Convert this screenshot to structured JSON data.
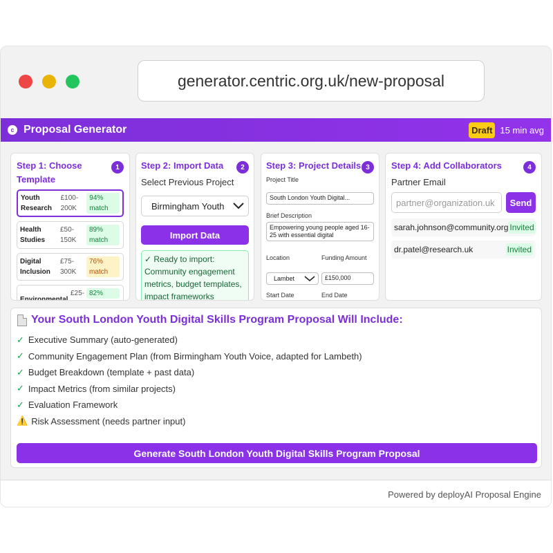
{
  "browser": {
    "url": "generator.centric.org.uk/new-proposal"
  },
  "app": {
    "logo_glyph": "c",
    "title": "Proposal Generator",
    "status_badge": "Draft",
    "avg_time": "15 min avg"
  },
  "step1": {
    "title": "Step 1: Choose Template",
    "number": "1",
    "templates": [
      {
        "name": "Youth Research",
        "range": "£100-200K",
        "match": "94% match"
      },
      {
        "name": "Health Studies",
        "range": "£50-150K",
        "match": "89% match"
      },
      {
        "name": "Digital Inclusion",
        "range": "£75-300K",
        "match": "76% match"
      },
      {
        "name": "Environmental",
        "range": "£25-",
        "match": "82%"
      }
    ]
  },
  "step2": {
    "title": "Step 2: Import Data",
    "number": "2",
    "label": "Select Previous Project",
    "selected_project": "Birmingham Youth",
    "button": "Import Data",
    "ready_text": "✓ Ready to import: Community engagement metrics, budget templates, impact frameworks"
  },
  "step3": {
    "title": "Step 3: Project Details",
    "number": "3",
    "project_title_label": "Project Title",
    "project_title_value": "South London Youth Digital...",
    "desc_label": "Brief Description",
    "desc_value": "Empowering young people aged 16-25 with essential digital",
    "location_label": "Location",
    "location_value": "Lambet",
    "funding_label": "Funding Amount",
    "funding_value": "£150,000",
    "start_label": "Start Date",
    "end_label": "End Date"
  },
  "step4": {
    "title": "Step 4: Add Collaborators",
    "number": "4",
    "email_label": "Partner Email",
    "email_placeholder": "partner@organization.uk",
    "send_button": "Send",
    "collaborators": [
      {
        "email": "sarah.johnson@community.org",
        "status": "Invited"
      },
      {
        "email": "dr.patel@research.uk",
        "status": "Invited"
      }
    ]
  },
  "summary": {
    "title": "Your South London Youth Digital Skills Program Proposal Will Include:",
    "items": [
      {
        "mark": "✓",
        "text": "Executive Summary (auto-generated)"
      },
      {
        "mark": "✓",
        "text": "Community Engagement Plan (from Birmingham Youth Voice, adapted for Lambeth)"
      },
      {
        "mark": "✓",
        "text": "Budget Breakdown (template + past data)"
      },
      {
        "mark": "✓",
        "text": "Impact Metrics (from similar projects)"
      },
      {
        "mark": "✓",
        "text": "Evaluation Framework"
      },
      {
        "mark": "⚠️",
        "text": "Risk Assessment (needs partner input)"
      }
    ],
    "generate_button": "Generate South London Youth Digital Skills Program Proposal"
  },
  "footer": {
    "text": "Powered by deployAI Proposal Engine"
  },
  "colors": {
    "accent": "#7c2fd9",
    "success": "#16a34a",
    "warning": "#eab308",
    "badge": "#facc15"
  }
}
